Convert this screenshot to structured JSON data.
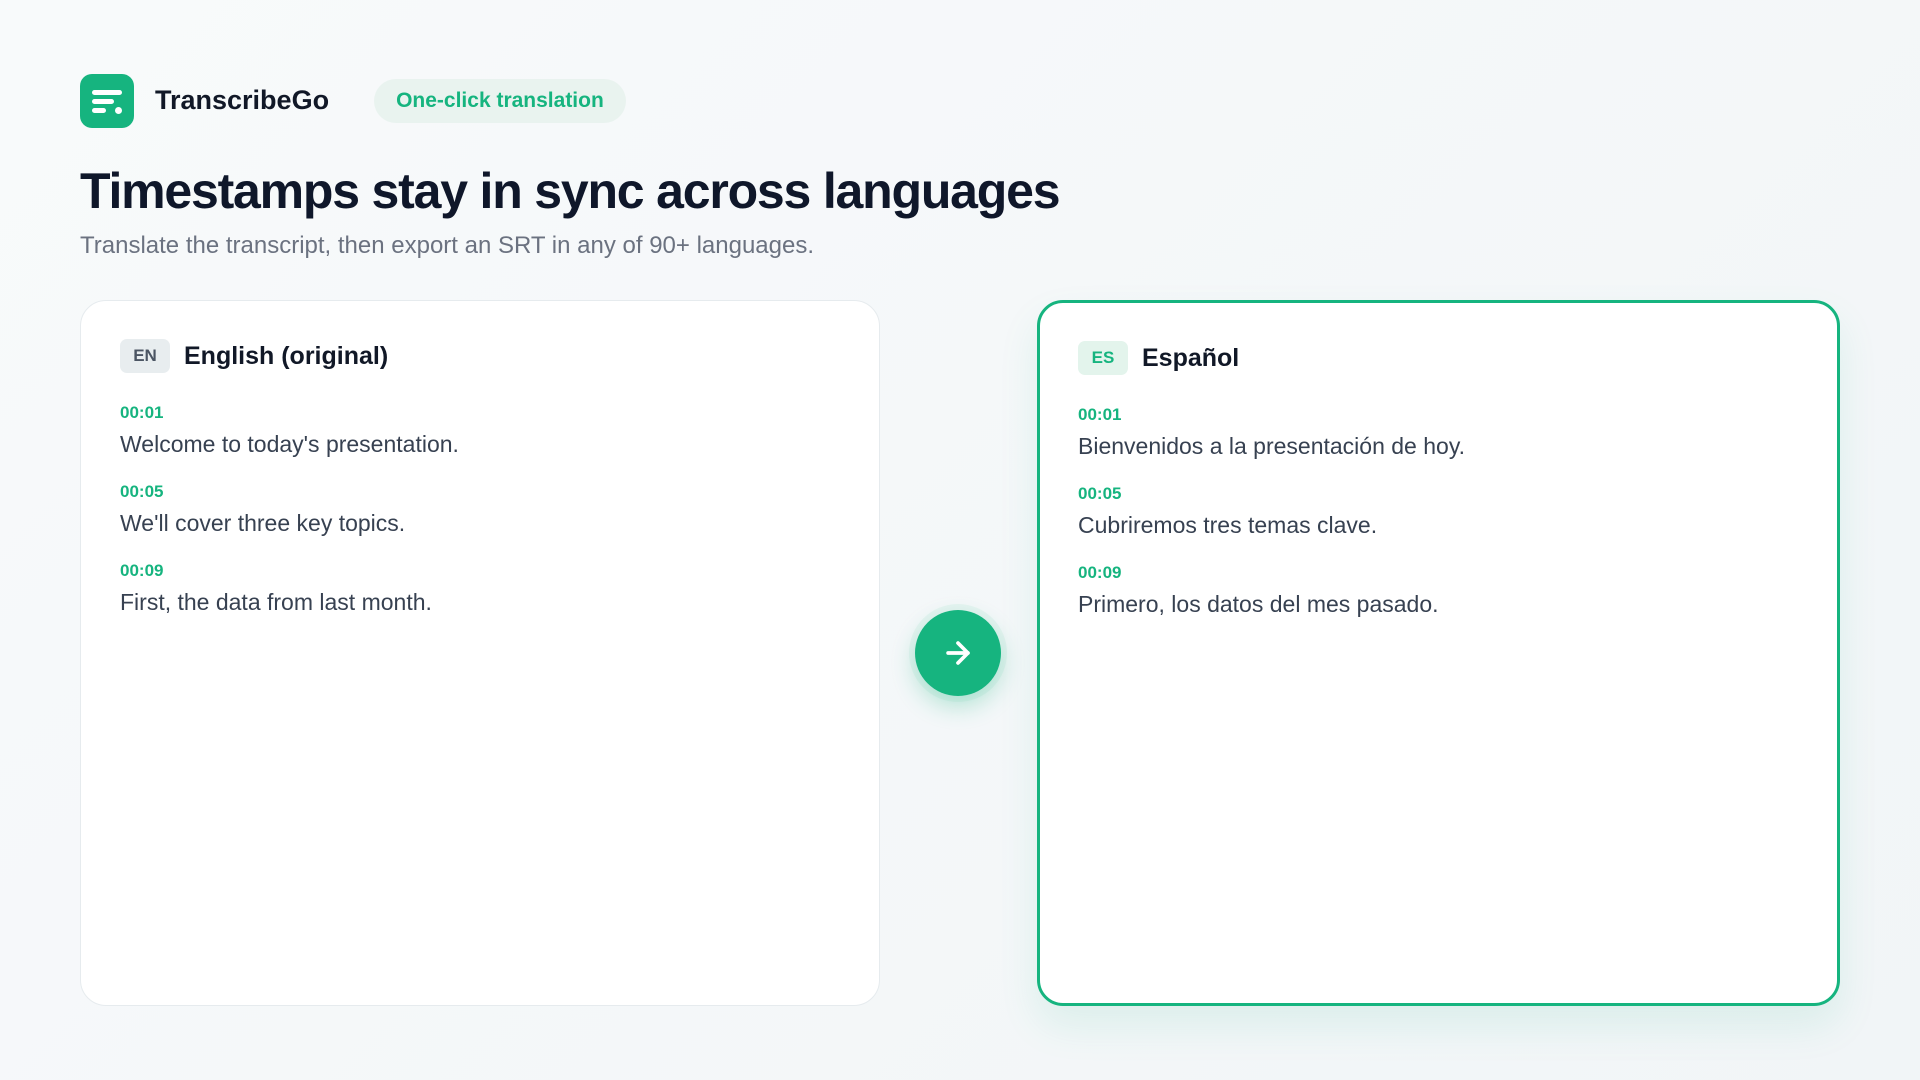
{
  "brand": {
    "name": "TranscribeGo",
    "logo_icon": "transcript-lines-icon",
    "accent": "#16b47f"
  },
  "badge": {
    "label": "One-click translation"
  },
  "hero": {
    "title": "Timestamps stay in sync across languages",
    "subtitle": "Translate the transcript, then export an SRT in any of 90+ languages."
  },
  "source": {
    "code": "EN",
    "label": "English (original)",
    "segments": [
      {
        "time": "00:01",
        "text": "Welcome to today's presentation."
      },
      {
        "time": "00:05",
        "text": "We'll cover three key topics."
      },
      {
        "time": "00:09",
        "text": "First, the data from last month."
      }
    ]
  },
  "translate_button": {
    "icon": "arrow-right-icon"
  },
  "target": {
    "code": "ES",
    "label": "Español",
    "segments": [
      {
        "time": "00:01",
        "text": "Bienvenidos a la presentación de hoy."
      },
      {
        "time": "00:05",
        "text": "Cubriremos tres temas clave."
      },
      {
        "time": "00:09",
        "text": "Primero, los datos del mes pasado."
      }
    ]
  }
}
